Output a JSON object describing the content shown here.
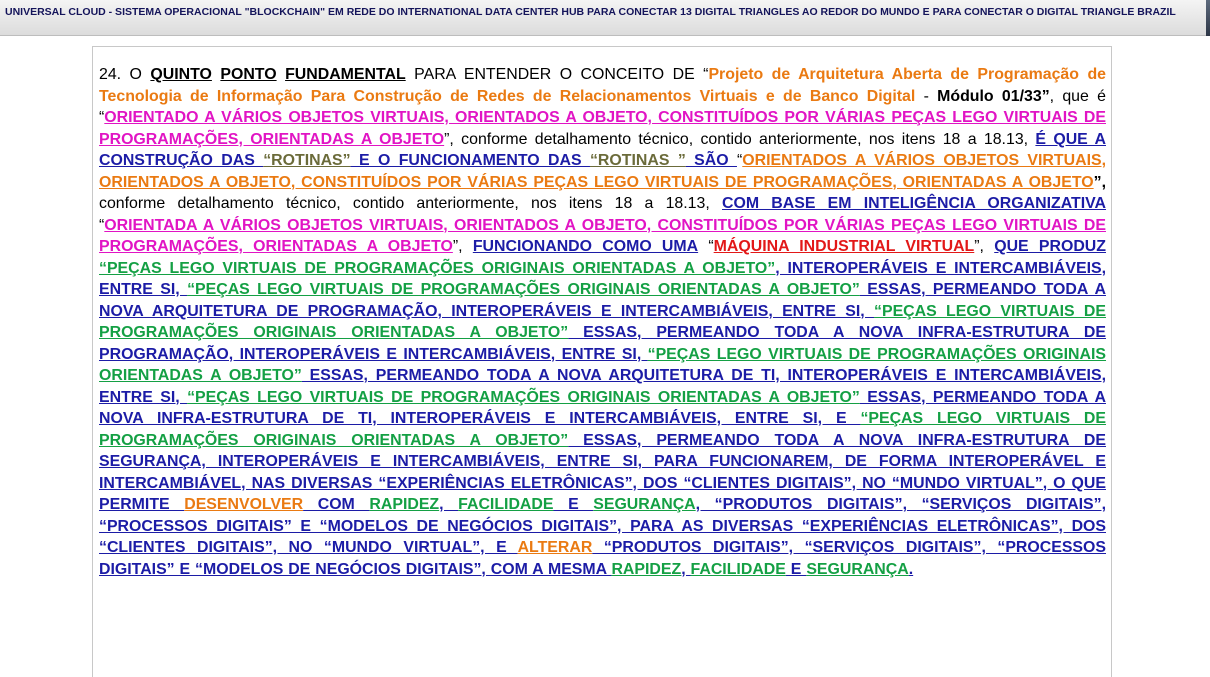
{
  "header": {
    "title": "UNIVERSAL CLOUD - SISTEMA OPERACIONAL \"BLOCKCHAIN\" EM REDE DO INTERNATIONAL DATA CENTER HUB PARA CONECTAR 13 DIGITAL TRIANGLES AO REDOR DO MUNDO E PARA CONECTAR O DIGITAL TRIANGLE BRAZIL"
  },
  "colors": {
    "black": "#000000",
    "navy": "#1c1ca6",
    "green": "#14a044",
    "magenta": "#e114c4",
    "orange": "#ea7a12",
    "red": "#e21818",
    "olive": "#6b6b3a"
  },
  "document": {
    "segments": [
      {
        "t": "24.    O ",
        "c": "blk"
      },
      {
        "t": "QUINTO",
        "c": "blk",
        "b": 1,
        "u": 1
      },
      {
        "t": " ",
        "c": "blk"
      },
      {
        "t": "PONTO",
        "c": "blk",
        "b": 1,
        "u": 1
      },
      {
        "t": " ",
        "c": "blk"
      },
      {
        "t": "FUNDAMENTAL",
        "c": "blk",
        "b": 1,
        "u": 1
      },
      {
        "t": " PARA ENTENDER O CONCEITO DE “",
        "c": "blk"
      },
      {
        "t": "Projeto de Arquitetura Aberta de Programação de Tecnologia de Informação Para Construção de Redes de Relacionamentos Virtuais e de Banco Digital",
        "c": "org",
        "b": 1
      },
      {
        "t": " - ",
        "c": "blk"
      },
      {
        "t": "Módulo 01/33”",
        "c": "blk",
        "b": 1
      },
      {
        "t": ", que é “",
        "c": "blk"
      },
      {
        "t": "ORIENTADO A VÁRIOS OBJETOS VIRTUAIS, ORIENTADOS A OBJETO, CONSTITUÍDOS POR VÁRIAS PEÇAS LEGO VIRTUAIS DE PROGRAMAÇÕES, ORIENTADAS A OBJETO",
        "c": "mag",
        "b": 1,
        "u": 1
      },
      {
        "t": "”, conforme detalhamento técnico, contido anteriormente, nos itens 18 a 18.13, ",
        "c": "blk"
      },
      {
        "t": "É QUE A CONSTRUÇÃO DAS ",
        "c": "nav",
        "b": 1,
        "u": 1
      },
      {
        "t": "“ROTINAS”",
        "c": "olv",
        "b": 1,
        "u": 1
      },
      {
        "t": " E O FUNCIONAMENTO DAS ",
        "c": "nav",
        "b": 1,
        "u": 1
      },
      {
        "t": "“ROTINAS ”",
        "c": "olv",
        "b": 1,
        "u": 1
      },
      {
        "t": " SÃO ",
        "c": "nav",
        "b": 1,
        "u": 1
      },
      {
        "t": "“",
        "c": "blk"
      },
      {
        "t": "ORIENTADOS A VÁRIOS OBJETOS VIRTUAIS, ORIENTADOS A OBJETO, CONSTITUÍDOS POR VÁRIAS PEÇAS LEGO VIRTUAIS DE PROGRAMAÇÕES, ORIENTADAS A OBJETO",
        "c": "org",
        "b": 1,
        "u": 1
      },
      {
        "t": "”,",
        "c": "blk",
        "b": 1
      },
      {
        "t": " conforme detalhamento técnico, contido anteriormente, nos itens 18 a 18.13, ",
        "c": "blk"
      },
      {
        "t": "COM BASE EM INTELIGÊNCIA ORGANIZATIVA",
        "c": "nav",
        "b": 1,
        "u": 1
      },
      {
        "t": " “",
        "c": "blk"
      },
      {
        "t": "ORIENTADA A VÁRIOS OBJETOS VIRTUAIS, ORIENTADOS A OBJETO, CONSTITUÍDOS POR VÁRIAS PEÇAS LEGO VIRTUAIS DE PROGRAMAÇÕES, ORIENTADAS A OBJETO",
        "c": "mag",
        "b": 1,
        "u": 1
      },
      {
        "t": "”, ",
        "c": "blk"
      },
      {
        "t": "FUNCIONANDO COMO UMA",
        "c": "nav",
        "b": 1,
        "u": 1
      },
      {
        "t": " “",
        "c": "blk"
      },
      {
        "t": "MÁQUINA INDUSTRIAL VIRTUAL",
        "c": "red",
        "b": 1,
        "u": 1
      },
      {
        "t": "”, ",
        "c": "blk"
      },
      {
        "t": "QUE PRODUZ",
        "c": "nav",
        "b": 1,
        "u": 1
      },
      {
        "t": " ",
        "c": "blk"
      },
      {
        "t": "“PEÇAS LEGO VIRTUAIS DE PROGRAMAÇÕES ORIGINAIS ORIENTADAS A OBJETO”",
        "c": "grn",
        "b": 1,
        "u": 1
      },
      {
        "t": ", INTEROPERÁVEIS E INTERCAMBIÁVEIS, ENTRE SI, ",
        "c": "nav",
        "b": 1,
        "u": 1
      },
      {
        "t": "“PEÇAS LEGO VIRTUAIS DE PROGRAMAÇÕES ORIGINAIS ORIENTADAS A OBJETO”",
        "c": "grn",
        "b": 1,
        "u": 1
      },
      {
        "t": " ESSAS, PERMEANDO TODA A NOVA ARQUITETURA DE PROGRAMAÇÃO, INTEROPERÁVEIS E INTERCAMBIÁVEIS, ENTRE SI, ",
        "c": "nav",
        "b": 1,
        "u": 1
      },
      {
        "t": "“PEÇAS LEGO VIRTUAIS DE PROGRAMAÇÕES ORIGINAIS ORIENTADAS A OBJETO”",
        "c": "grn",
        "b": 1,
        "u": 1
      },
      {
        "t": " ESSAS, PERMEANDO TODA A NOVA INFRA-ESTRUTURA DE PROGRAMAÇÃO, INTEROPERÁVEIS E INTERCAMBIÁVEIS, ENTRE SI, ",
        "c": "nav",
        "b": 1,
        "u": 1
      },
      {
        "t": "“PEÇAS LEGO VIRTUAIS DE PROGRAMAÇÕES ORIGINAIS ORIENTADAS A OBJETO”",
        "c": "grn",
        "b": 1,
        "u": 1
      },
      {
        "t": " ESSAS, PERMEANDO TODA A NOVA ARQUITETURA DE TI, INTEROPERÁVEIS E INTERCAMBIÁVEIS, ENTRE SI, ",
        "c": "nav",
        "b": 1,
        "u": 1
      },
      {
        "t": "“PEÇAS LEGO VIRTUAIS DE PROGRAMAÇÕES ORIGINAIS ORIENTADAS A OBJETO”",
        "c": "grn",
        "b": 1,
        "u": 1
      },
      {
        "t": " ESSAS, PERMEANDO TODA A NOVA INFRA-ESTRUTURA DE TI, INTEROPERÁVEIS E INTERCAMBIÁVEIS, ENTRE SI, E ",
        "c": "nav",
        "b": 1,
        "u": 1
      },
      {
        "t": "“PEÇAS LEGO VIRTUAIS DE PROGRAMAÇÕES ORIGINAIS ORIENTADAS A OBJETO”",
        "c": "grn",
        "b": 1,
        "u": 1
      },
      {
        "t": " ESSAS, PERMEANDO TODA A NOVA INFRA-ESTRUTURA DE SEGURANÇA, INTEROPERÁVEIS E INTERCAMBIÁVEIS, ENTRE SI, PARA FUNCIONAREM, DE FORMA INTEROPERÁVEL E INTERCAMBIÁVEL, NAS DIVERSAS “EXPERIÊNCIAS ELETRÔNICAS”, DOS “CLIENTES DIGITAIS”, NO “MUNDO VIRTUAL”, O QUE PERMITE ",
        "c": "nav",
        "b": 1,
        "u": 1
      },
      {
        "t": "DESENVOLVER",
        "c": "org",
        "b": 1,
        "u": 1
      },
      {
        "t": " COM ",
        "c": "nav",
        "b": 1,
        "u": 1
      },
      {
        "t": "RAPIDEZ",
        "c": "grn",
        "b": 1,
        "u": 1
      },
      {
        "t": ", ",
        "c": "nav",
        "b": 1,
        "u": 1
      },
      {
        "t": "FACILIDADE",
        "c": "grn",
        "b": 1,
        "u": 1
      },
      {
        "t": " E ",
        "c": "nav",
        "b": 1,
        "u": 1
      },
      {
        "t": "SEGURANÇA",
        "c": "grn",
        "b": 1,
        "u": 1
      },
      {
        "t": ", “PRODUTOS DIGITAIS”, “SERVIÇOS DIGITAIS”, “PROCESSOS DIGITAIS” E “MODELOS DE NEGÓCIOS DIGITAIS”, PARA AS DIVERSAS “EXPERIÊNCIAS ELETRÔNICAS”, DOS “CLIENTES DIGITAIS”, NO “MUNDO VIRTUAL”, E ",
        "c": "nav",
        "b": 1,
        "u": 1
      },
      {
        "t": "ALTERAR",
        "c": "org",
        "b": 1,
        "u": 1
      },
      {
        "t": " “PRODUTOS DIGITAIS”, “SERVIÇOS DIGITAIS”, “PROCESSOS DIGITAIS” E “MODELOS DE NEGÓCIOS DIGITAIS”, COM A MESMA ",
        "c": "nav",
        "b": 1,
        "u": 1
      },
      {
        "t": "RAPIDEZ",
        "c": "grn",
        "b": 1,
        "u": 1
      },
      {
        "t": ", ",
        "c": "nav",
        "b": 1,
        "u": 1
      },
      {
        "t": "FACILIDADE",
        "c": "grn",
        "b": 1,
        "u": 1
      },
      {
        "t": " E ",
        "c": "nav",
        "b": 1,
        "u": 1
      },
      {
        "t": "SEGURANÇA",
        "c": "grn",
        "b": 1,
        "u": 1
      },
      {
        "t": ".",
        "c": "nav",
        "b": 1,
        "u": 1
      }
    ]
  }
}
